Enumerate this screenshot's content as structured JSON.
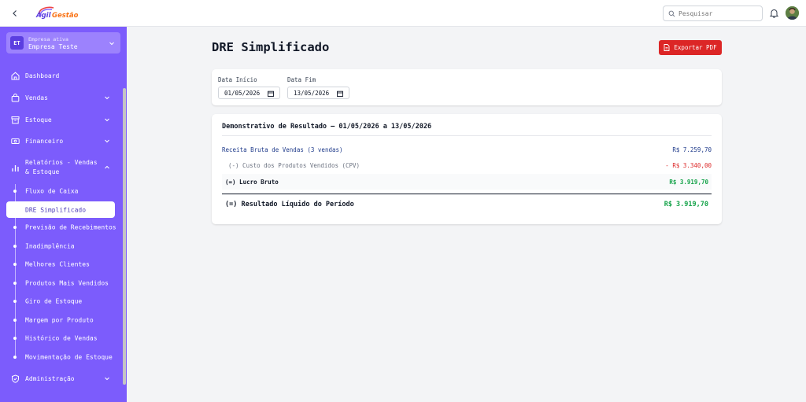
{
  "header": {
    "search_placeholder": "Pesquisar",
    "brand_color": "#7c5cfc"
  },
  "sidebar": {
    "company": {
      "badge": "ET",
      "label": "Empresa ativa",
      "name": "Empresa Teste"
    },
    "items": [
      {
        "label": "Dashboard",
        "icon": "home-icon"
      },
      {
        "label": "Vendas",
        "icon": "shopping-bag-icon"
      },
      {
        "label": "Estoque",
        "icon": "archive-box-icon"
      },
      {
        "label": "Financeiro",
        "icon": "banknote-icon"
      },
      {
        "label": "Relatórios - Vendas & Estoque",
        "icon": "bar-chart-icon"
      },
      {
        "label": "Administração",
        "icon": "shield-check-icon"
      }
    ],
    "subitems": [
      "Fluxo de Caixa",
      "DRE Simplificado",
      "Previsão de Recebimentos",
      "Inadimplência",
      "Melhores Clientes",
      "Produtos Mais Vendidos",
      "Giro de Estoque",
      "Margem por Produto",
      "Histórico de Vendas",
      "Movimentação de Estoque"
    ]
  },
  "main": {
    "title": "DRE Simplificado",
    "export_label": "Exportar PDF",
    "filters": {
      "start_label": "Data Início",
      "start_value": "01/05/2026",
      "end_label": "Data Fim",
      "end_value": "13/05/2026"
    },
    "report": {
      "title": "Demonstrativo de Resultado — 01/05/2026 a 13/05/2026",
      "rows": [
        {
          "label": "Receita Bruta de Vendas (3 vendas)",
          "value": "R$ 7.259,70",
          "label_color": "#1e3a8a",
          "value_color": "#1e3a8a"
        },
        {
          "label": "(-) Custo dos Produtos Vendidos (CPV)",
          "value": "- R$ 3.340,00",
          "label_color": "#6b7280",
          "value_color": "#dc2626"
        },
        {
          "label": "(=) Lucro Bruto",
          "value": "R$ 3.919,70",
          "label_color": "#111827",
          "value_color": "#16a34a"
        }
      ],
      "result_label": "(=) Resultado Líquido do Período",
      "result_value": "R$ 3.919,70"
    }
  }
}
